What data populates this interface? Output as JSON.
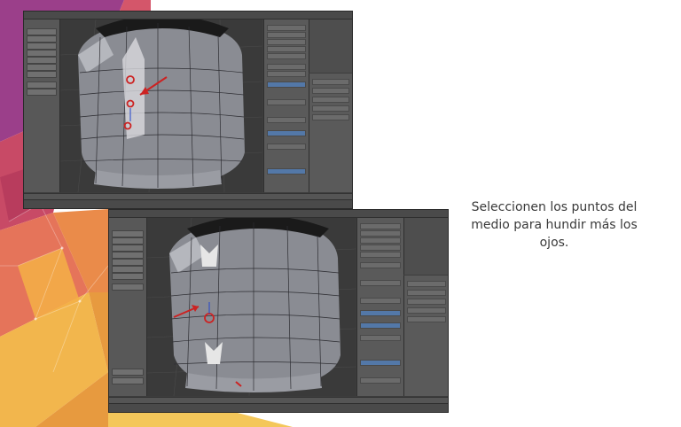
{
  "caption": {
    "text": "Seleccionen los puntos del medio para hundir más los ojos."
  },
  "colors": {
    "annotation_red": "#cc2222",
    "mesh_gray": "#8a8c93",
    "selection_white": "#e6e6e6",
    "panel_blue": "#5378a8",
    "background_art": [
      "#d4566a",
      "#e98a3c",
      "#f2b64d",
      "#9b3f8a"
    ]
  },
  "screenshots": [
    {
      "app": "Blender 3D",
      "step": "select middle vertices",
      "annotation": "red arrow and circles on mesh"
    },
    {
      "app": "Blender 3D",
      "step": "move vertices inward",
      "annotation": "red arrow and circle on mesh"
    }
  ]
}
